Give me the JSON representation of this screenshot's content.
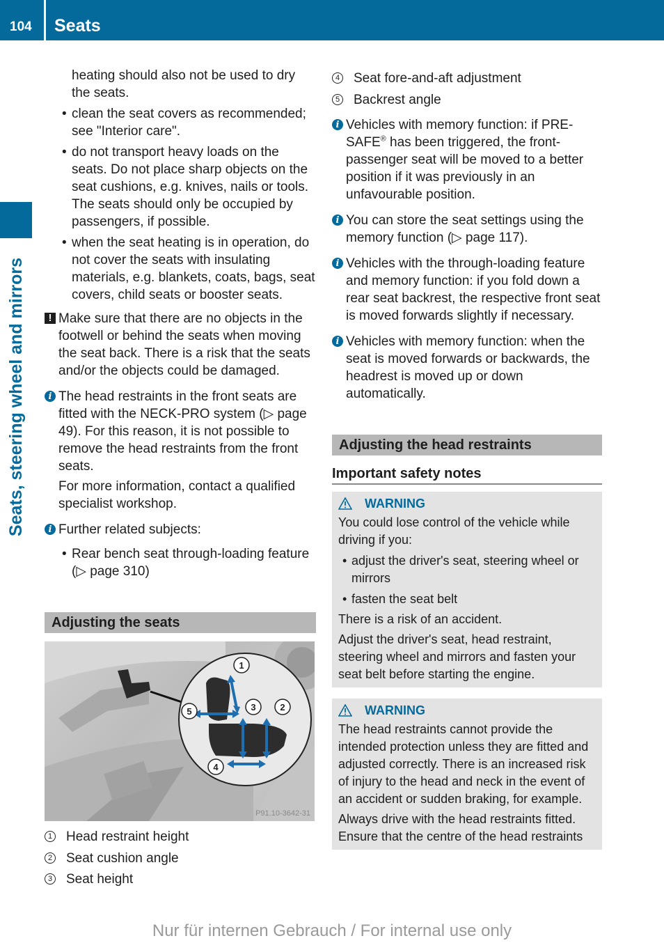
{
  "header": {
    "page_number": "104",
    "chapter": "Seats"
  },
  "side_tab": {
    "label": "Seats, steering wheel and mirrors"
  },
  "left_column": {
    "continued_text": "heating should also not be used to dry the seats.",
    "bullets": [
      "clean the seat covers as recommended; see \"Interior care\".",
      "do not transport heavy loads on the seats. Do not place sharp objects on the seat cushions, e.g. knives, nails or tools. The seats should only be occupied by passengers, if possible.",
      "when the seat heating is in operation, do not cover the seats with insulating materials, e.g. blankets, coats, bags, seat covers, child seats or booster seats."
    ],
    "caution_note": "Make sure that there are no objects in the footwell or behind the seats when moving the seat back. There is a risk that the seats and/or the objects could be damaged.",
    "info_neck_pro": {
      "text": "The head restraints in the front seats are fitted with the NECK-PRO system (▷ page 49). For this reason, it is not possible to remove the head restraints from the front seats.",
      "extra": "For more information, contact a qualified specialist workshop."
    },
    "info_related": {
      "text": "Further related subjects:",
      "items": [
        "Rear bench seat through-loading feature (▷ page 310)"
      ]
    },
    "section_title": "Adjusting the seats",
    "figure": {
      "callouts": [
        "1",
        "2",
        "3",
        "4",
        "5"
      ],
      "code": "P91.10-3642-31"
    },
    "legend": [
      {
        "num": "1",
        "label": "Head restraint height"
      },
      {
        "num": "2",
        "label": "Seat cushion angle"
      },
      {
        "num": "3",
        "label": "Seat height"
      }
    ]
  },
  "right_column": {
    "legend": [
      {
        "num": "4",
        "label": "Seat fore-and-aft adjustment"
      },
      {
        "num": "5",
        "label": "Backrest angle"
      }
    ],
    "info_presafe": {
      "before": "Vehicles with memory function: if PRE-SAFE",
      "mark": "®",
      "after": " has been triggered, the front-passenger seat will be moved to a better position if it was previously in an unfavourable position."
    },
    "info_notes": [
      "You can store the seat settings using the memory function (▷ page 117).",
      "Vehicles with the through-loading feature and memory function: if you fold down a rear seat backrest, the respective front seat is moved forwards slightly if necessary.",
      "Vehicles with memory function: when the seat is moved forwards or backwards, the headrest is moved up or down automatically."
    ],
    "section_title": "Adjusting the head restraints",
    "subheading": "Important safety notes",
    "warning1": {
      "title": "WARNING",
      "intro": "You could lose control of the vehicle while driving if you:",
      "bullets": [
        "adjust the driver's seat, steering wheel or mirrors",
        "fasten the seat belt"
      ],
      "risk": "There is a risk of an accident.",
      "action": "Adjust the driver's seat, head restraint, steering wheel and mirrors and fasten your seat belt before starting the engine."
    },
    "warning2": {
      "title": "WARNING",
      "text": "The head restraints cannot provide the intended protection unless they are fitted and adjusted correctly. There is an increased risk of injury to the head and neck in the event of an accident or sudden braking, for example.",
      "text2": "Always drive with the head restraints fitted. Ensure that the centre of the head restraints"
    }
  },
  "footer": {
    "watermark": "Nur für internen Gebrauch / For internal use only"
  },
  "colors": {
    "brand_blue": "#046a9c",
    "section_bar": "#b7b7b7",
    "warning_box": "#e3e3e3"
  }
}
